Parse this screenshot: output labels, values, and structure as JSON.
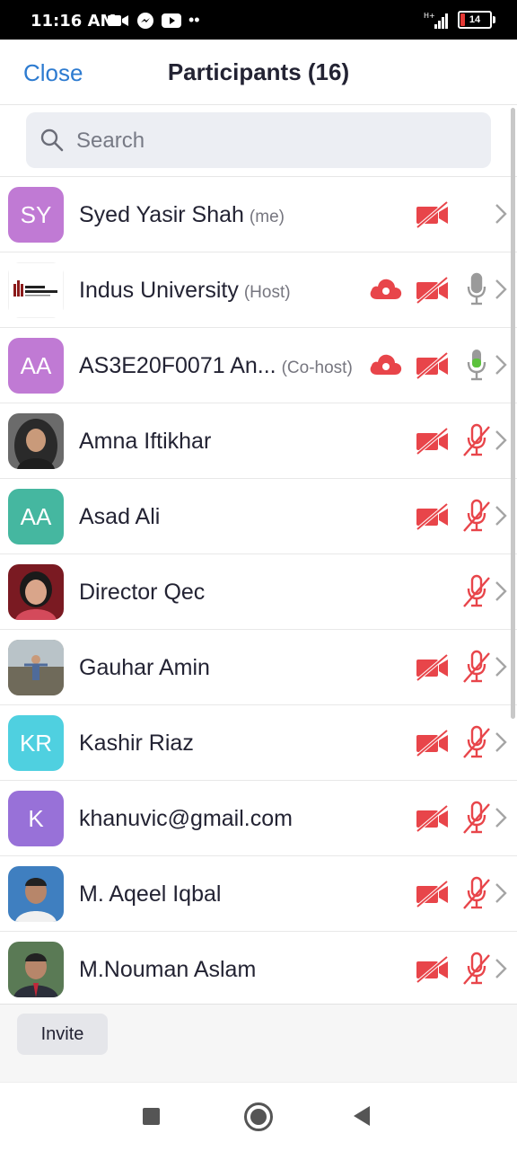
{
  "status_bar": {
    "time": "11:16 AM",
    "battery": "14",
    "network": "H+"
  },
  "header": {
    "close_label": "Close",
    "title": "Participants (16)"
  },
  "search": {
    "placeholder": "Search"
  },
  "participants": [
    {
      "name": "Syed Yasir Shah",
      "role": "(me)",
      "initials": "SY",
      "avatar_color": "#c07ad4",
      "avatar_type": "initials",
      "cloud": false,
      "video": "off",
      "mic": "none"
    },
    {
      "name": "Indus University",
      "role": "(Host)",
      "initials": "",
      "avatar_type": "logo",
      "logo_text": "INDUS UNIVERSITY",
      "cloud": true,
      "video": "off",
      "mic": "on-gray"
    },
    {
      "name": "AS3E20F0071 An...",
      "role": "(Co-host)",
      "initials": "AA",
      "avatar_color": "#c07ad4",
      "avatar_type": "initials",
      "cloud": true,
      "video": "off",
      "mic": "on-green"
    },
    {
      "name": "Amna Iftikhar",
      "role": "",
      "avatar_type": "photo",
      "photo_style": "hijab",
      "cloud": false,
      "video": "off",
      "mic": "muted"
    },
    {
      "name": "Asad Ali",
      "role": "",
      "initials": "AA",
      "avatar_color": "#45b7a0",
      "avatar_type": "initials",
      "cloud": false,
      "video": "off",
      "mic": "muted"
    },
    {
      "name": "Director Qec",
      "role": "",
      "avatar_type": "photo",
      "photo_style": "woman",
      "cloud": false,
      "video": "none",
      "mic": "muted"
    },
    {
      "name": "Gauhar Amin",
      "role": "",
      "avatar_type": "photo",
      "photo_style": "outdoor",
      "cloud": false,
      "video": "off",
      "mic": "muted"
    },
    {
      "name": "Kashir Riaz",
      "role": "",
      "initials": "KR",
      "avatar_color": "#4fd0e0",
      "avatar_type": "initials",
      "cloud": false,
      "video": "off",
      "mic": "muted"
    },
    {
      "name": "khanuvic@gmail.com",
      "role": "",
      "initials": "K",
      "avatar_color": "#9871d8",
      "avatar_type": "initials",
      "cloud": false,
      "video": "off",
      "mic": "muted"
    },
    {
      "name": "M. Aqeel Iqbal",
      "role": "",
      "avatar_type": "photo",
      "photo_style": "man-blue",
      "cloud": false,
      "video": "off",
      "mic": "muted"
    },
    {
      "name": "M.Nouman Aslam",
      "role": "",
      "avatar_type": "photo",
      "photo_style": "man-suit",
      "cloud": false,
      "video": "off",
      "mic": "muted"
    }
  ],
  "footer": {
    "invite_label": "Invite"
  },
  "colors": {
    "accent": "#2d7bd0",
    "muted_red": "#e8454a",
    "mic_green": "#5cc23c",
    "mic_gray": "#9a9a9a"
  }
}
